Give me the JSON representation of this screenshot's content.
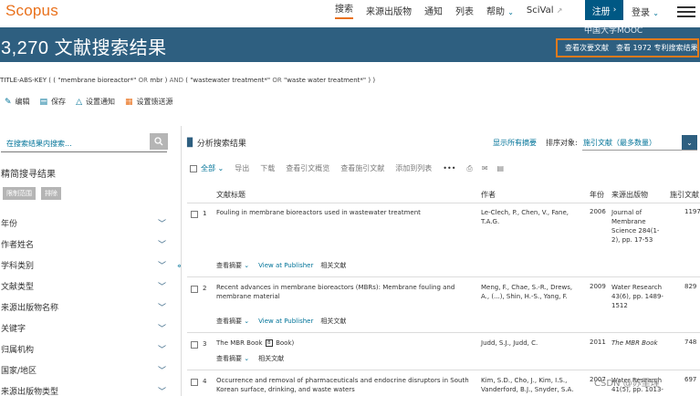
{
  "nav": {
    "logo": "Scopus",
    "search": "搜索",
    "sources": "来源出版物",
    "alerts": "通知",
    "lists": "列表",
    "help": "帮助",
    "scival": "SciVal",
    "register": "注册",
    "login": "登录"
  },
  "band": {
    "title": "3,270 文献搜索结果",
    "watermark": "中国大学MOOC",
    "secondary": "查看次要文献",
    "patents": "查看 1972 专利搜索结果"
  },
  "query": {
    "key": "TITLE-ABS-KEY",
    "t1": "\"membrane bioreactor*\"",
    "or1": "OR",
    "t2": "mbr",
    "and": "AND",
    "t3": "\"wastewater treatment*\"",
    "or2": "OR",
    "t4": "\"waste water treatment*\""
  },
  "actions": {
    "edit": "编辑",
    "save": "保存",
    "set_alert": "设置通知",
    "set_feed": "设置馈送源"
  },
  "left": {
    "search_placeholder": "在搜索结果内搜索...",
    "refine_title": "精简搜寻结果",
    "limit": "限制范围",
    "exclude": "排除",
    "facets": [
      "年份",
      "作者姓名",
      "学科类别",
      "文献类型",
      "来源出版物名称",
      "关键字",
      "归属机构",
      "国家/地区",
      "来源出版物类型"
    ]
  },
  "results_header": {
    "analyze": "分析搜索结果",
    "show_abstracts": "显示所有摘要",
    "sort_label": "排序对象:",
    "sort_value": "施引文献（最多数量）"
  },
  "toolbar": {
    "all": "全部",
    "export": "导出",
    "download": "下载",
    "citation_overview": "查看引文概览",
    "cited_by": "查看施引文献",
    "add_to_list": "添加到列表",
    "more": "•••"
  },
  "columns": {
    "title": "文献标题",
    "authors": "作者",
    "year": "年份",
    "source": "来源出版物",
    "cites": "施引文献"
  },
  "results": [
    {
      "num": "1",
      "title": "Fouling in membrane bioreactors used in wastewater treatment",
      "authors": "Le-Clech, P., Chen, V., Fane, T.A.G.",
      "year": "2006",
      "source": "Journal of Membrane Science 284(1-2), pp. 17-53",
      "cites": "1197",
      "view_abstract": "查看摘要",
      "view_publisher": "View at Publisher",
      "related": "相关文献"
    },
    {
      "num": "2",
      "title": "Recent advances in membrane bioreactors (MBRs): Membrane fouling and membrane material",
      "authors": "Meng, F., Chae, S.-R., Drews, A., (...), Shin, H.-S., Yang, F.",
      "year": "2009",
      "source": "Water Research 43(6), pp. 1489-1512",
      "cites": "829",
      "view_abstract": "查看摘要",
      "view_publisher": "View at Publisher",
      "related": "相关文献"
    },
    {
      "num": "3",
      "title_a": "The MBR Book",
      "title_b": "Book)",
      "authors": "Judd, S.J., Judd, C.",
      "year": "2011",
      "source": "The MBR Book",
      "cites": "748",
      "view_abstract": "查看摘要",
      "related": "相关文献"
    },
    {
      "num": "4",
      "title": "Occurrence and removal of pharmaceuticals and endocrine disruptors in South Korean surface, drinking, and waste waters",
      "authors": "Kim, S.D., Cho, J., Kim, I.S., Vanderford, B.J., Snyder, S.A.",
      "year": "2007",
      "source": "Water Research 41(5), pp. 1013-",
      "cites": "697"
    }
  ],
  "watermark_csdn": "CSDN @苏里理"
}
